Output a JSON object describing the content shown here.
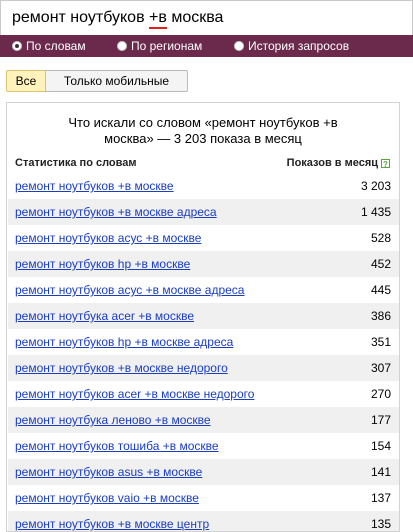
{
  "search": {
    "query_before": "ремонт ноутбуков ",
    "query_underlined": "+в",
    "query_after": " москва"
  },
  "modes": [
    {
      "label": "По словам",
      "checked": true
    },
    {
      "label": "По регионам",
      "checked": false
    },
    {
      "label": "История запросов",
      "checked": false
    }
  ],
  "filters": {
    "all_label": "Все",
    "mobile_label": "Только мобильные"
  },
  "panel": {
    "title_line1": "Что искали со словом «ремонт ноутбуков +в",
    "title_line2": "москва» — 3 203 показа в месяц",
    "col_left": "Статистика по словам",
    "col_right": "Показов в месяц",
    "help_icon_glyph": "?"
  },
  "rows": [
    {
      "phrase": "ремонт ноутбуков +в москве",
      "count": "3 203"
    },
    {
      "phrase": "ремонт ноутбуков +в москве адреса",
      "count": "1 435"
    },
    {
      "phrase": "ремонт ноутбуков асус +в москве",
      "count": "528"
    },
    {
      "phrase": "ремонт ноутбуков hp +в москве",
      "count": "452"
    },
    {
      "phrase": "ремонт ноутбуков асус +в москве адреса",
      "count": "445"
    },
    {
      "phrase": "ремонт ноутбука acer +в москве",
      "count": "386"
    },
    {
      "phrase": "ремонт ноутбуков hp +в москве адреса",
      "count": "351"
    },
    {
      "phrase": "ремонт ноутбуков +в москве недорого",
      "count": "307"
    },
    {
      "phrase": "ремонт ноутбуков acer +в москве недорого",
      "count": "270"
    },
    {
      "phrase": "ремонт ноутбука леново +в москве",
      "count": "177"
    },
    {
      "phrase": "ремонт ноутбуков тошиба +в москве",
      "count": "154"
    },
    {
      "phrase": "ремонт ноутбуков asus +в москве",
      "count": "141"
    },
    {
      "phrase": "ремонт ноутбуков vaio +в москве",
      "count": "137"
    },
    {
      "phrase": "ремонт ноутбуков +в москве центр",
      "count": "135"
    }
  ],
  "colors": {
    "mode_bar": "#6b2a4b",
    "link": "#1a3dc1",
    "active_filter": "#fff2bd",
    "underline_accent": "#e0201b"
  }
}
